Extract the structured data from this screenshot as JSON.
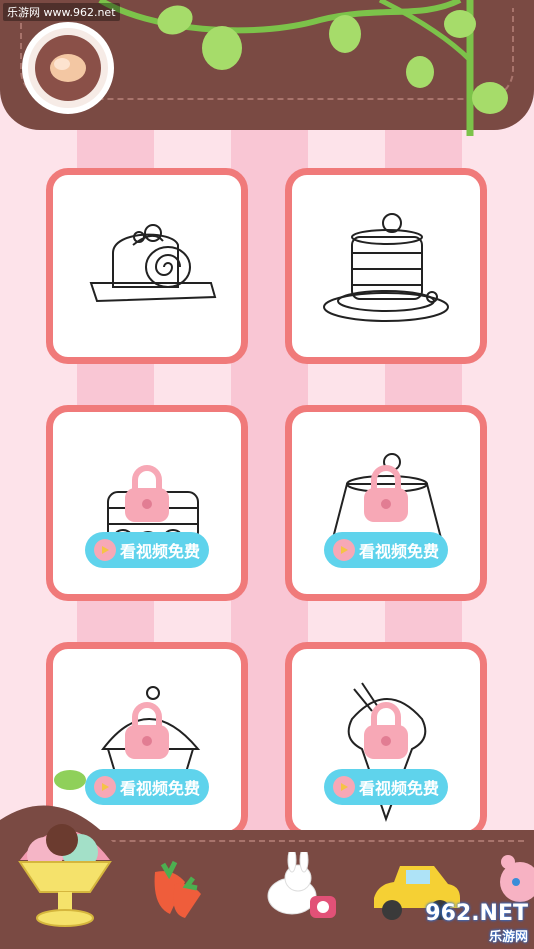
{
  "brand": {
    "watermark_top": "乐游网 www.962.net"
  },
  "cards": [
    {
      "name": "swiss-roll",
      "locked": false
    },
    {
      "name": "pancake-stack",
      "locked": false
    },
    {
      "name": "pancake-stack-2",
      "locked": true,
      "unlock_label": "看视频免费"
    },
    {
      "name": "pudding",
      "locked": true,
      "unlock_label": "看视频免费"
    },
    {
      "name": "cupcake",
      "locked": true,
      "unlock_label": "看视频免费"
    },
    {
      "name": "ice-cream-cone",
      "locked": true,
      "unlock_label": "看视频免费"
    }
  ],
  "footer_logo": {
    "brand": "962.NET",
    "sub": "乐游网"
  },
  "colors": {
    "card_border": "#f07a7a",
    "unlock_button": "#5fd3ec",
    "header": "#7a4a43",
    "lock": "#f7a8b6"
  },
  "icons": [
    "back-icon",
    "lock-icon",
    "play-icon",
    "ice-cream-icon",
    "carrot-icon",
    "bunny-icon",
    "car-icon",
    "bear-icon"
  ]
}
